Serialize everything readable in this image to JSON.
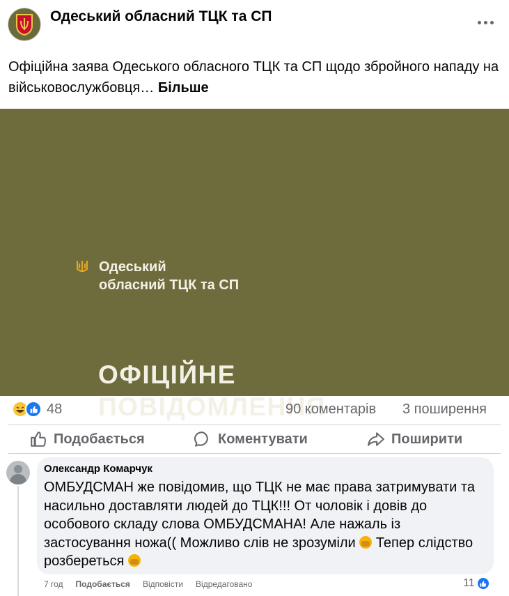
{
  "post": {
    "page_name": "Одеський обласний ТЦК та СП",
    "text": "Офіційна заява Одеського обласного ТЦК та СП щодо збройного нападу на військовослужбовця…",
    "see_more": "Більше",
    "image": {
      "org_line1": "Одеський",
      "org_line2": "обласний ТЦК та СП",
      "title_line1": "ОФІЦІЙНЕ",
      "title_line2": "ПОВІДОМЛЕННЯ",
      "background_color": "#6e6b3c"
    },
    "reactions": {
      "icons": [
        "haha-icon",
        "like-icon"
      ],
      "count": "48"
    },
    "comments_count": "90 коментарів",
    "shares_count": "3 поширення"
  },
  "actions": {
    "like": "Подобається",
    "comment": "Коментувати",
    "share": "Поширити"
  },
  "comment": {
    "author": "Олександр Комарчук",
    "text_part1": "ОМБУДСМАН же повідомив, що ТЦК не має права затримувати та насильно доставляти людей до ТЦК!!! От чоловік і довів до особового складу слова ОМБУДСМАНА! Але нажаль із застосування ножа(( Можливо слів не зрозуміли ",
    "text_part2": " Тепер слідство розбереться ",
    "time": "7 год",
    "like_label": "Подобається",
    "reply_label": "Відповісти",
    "edited_label": "Відредаговано",
    "reaction_count": "11"
  },
  "colors": {
    "accent": "#1877f2",
    "secondary_text": "#65676b",
    "bubble": "#f0f2f5"
  }
}
